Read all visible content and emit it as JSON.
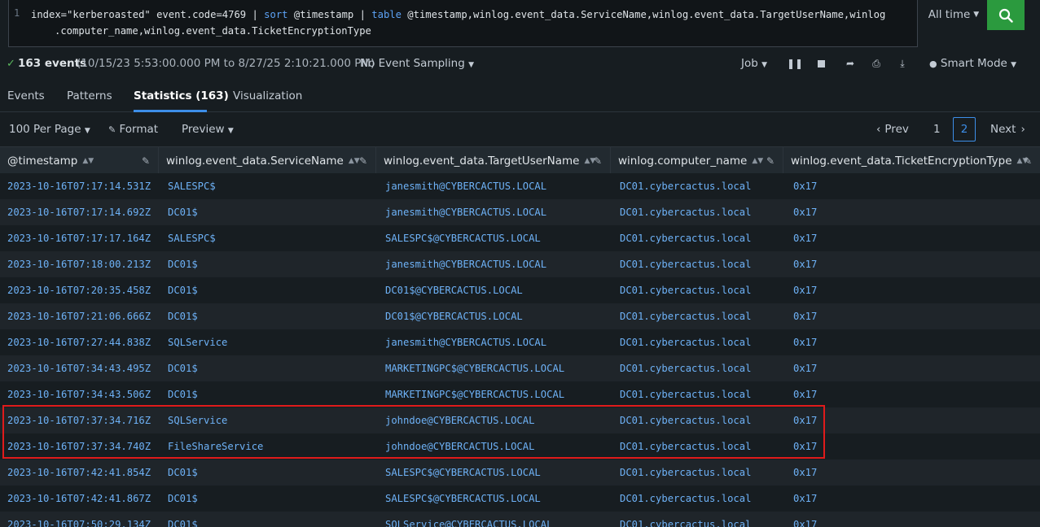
{
  "search": {
    "line_number": "1",
    "query_part1": "index=\"kerberoasted\" event.code=4769 | ",
    "query_kw_sort": "sort",
    "query_part2": " @timestamp | ",
    "query_kw_table": "table",
    "query_part3": " @timestamp,winlog.event_data.ServiceName,winlog.event_data.TargetUserName,winlog",
    "query_line2": ".computer_name,winlog.event_data.TicketEncryptionType",
    "time_range": "All time"
  },
  "status": {
    "count": "163 events",
    "range": "(10/15/23 5:53:00.000 PM to 8/27/25 2:10:21.000 PM)",
    "sampling": "No Event Sampling",
    "job": "Job",
    "mode": "Smart Mode"
  },
  "tabs": [
    {
      "label": "Events"
    },
    {
      "label": "Patterns"
    },
    {
      "label": "Statistics (163)"
    },
    {
      "label": "Visualization"
    }
  ],
  "controls": {
    "per_page": "100 Per Page",
    "format": "Format",
    "preview": "Preview",
    "prev": "Prev",
    "page1": "1",
    "page2": "2",
    "next": "Next"
  },
  "table": {
    "headers": [
      "@timestamp",
      "winlog.event_data.ServiceName",
      "winlog.event_data.TargetUserName",
      "winlog.computer_name",
      "winlog.event_data.TicketEncryptionType"
    ],
    "rows": [
      [
        "2023-10-16T07:17:14.531Z",
        "SALESPC$",
        "janesmith@CYBERCACTUS.LOCAL",
        "DC01.cybercactus.local",
        "0x17"
      ],
      [
        "2023-10-16T07:17:14.692Z",
        "DC01$",
        "janesmith@CYBERCACTUS.LOCAL",
        "DC01.cybercactus.local",
        "0x17"
      ],
      [
        "2023-10-16T07:17:17.164Z",
        "SALESPC$",
        "SALESPC$@CYBERCACTUS.LOCAL",
        "DC01.cybercactus.local",
        "0x17"
      ],
      [
        "2023-10-16T07:18:00.213Z",
        "DC01$",
        "janesmith@CYBERCACTUS.LOCAL",
        "DC01.cybercactus.local",
        "0x17"
      ],
      [
        "2023-10-16T07:20:35.458Z",
        "DC01$",
        "DC01$@CYBERCACTUS.LOCAL",
        "DC01.cybercactus.local",
        "0x17"
      ],
      [
        "2023-10-16T07:21:06.666Z",
        "DC01$",
        "DC01$@CYBERCACTUS.LOCAL",
        "DC01.cybercactus.local",
        "0x17"
      ],
      [
        "2023-10-16T07:27:44.838Z",
        "SQLService",
        "janesmith@CYBERCACTUS.LOCAL",
        "DC01.cybercactus.local",
        "0x17"
      ],
      [
        "2023-10-16T07:34:43.495Z",
        "DC01$",
        "MARKETINGPC$@CYBERCACTUS.LOCAL",
        "DC01.cybercactus.local",
        "0x17"
      ],
      [
        "2023-10-16T07:34:43.506Z",
        "DC01$",
        "MARKETINGPC$@CYBERCACTUS.LOCAL",
        "DC01.cybercactus.local",
        "0x17"
      ],
      [
        "2023-10-16T07:37:34.716Z",
        "SQLService",
        "johndoe@CYBERCACTUS.LOCAL",
        "DC01.cybercactus.local",
        "0x17"
      ],
      [
        "2023-10-16T07:37:34.740Z",
        "FileShareService",
        "johndoe@CYBERCACTUS.LOCAL",
        "DC01.cybercactus.local",
        "0x17"
      ],
      [
        "2023-10-16T07:42:41.854Z",
        "DC01$",
        "SALESPC$@CYBERCACTUS.LOCAL",
        "DC01.cybercactus.local",
        "0x17"
      ],
      [
        "2023-10-16T07:42:41.867Z",
        "DC01$",
        "SALESPC$@CYBERCACTUS.LOCAL",
        "DC01.cybercactus.local",
        "0x17"
      ],
      [
        "2023-10-16T07:50:29.134Z",
        "DC01$",
        "SQLService@CYBERCACTUS.LOCAL",
        "DC01.cybercactus.local",
        "0x17"
      ]
    ]
  },
  "colors": {
    "accent": "#3d8ee8",
    "search_button": "#2b9a3e",
    "highlight": "#e01b1b",
    "link_text": "#6eb2f7"
  }
}
